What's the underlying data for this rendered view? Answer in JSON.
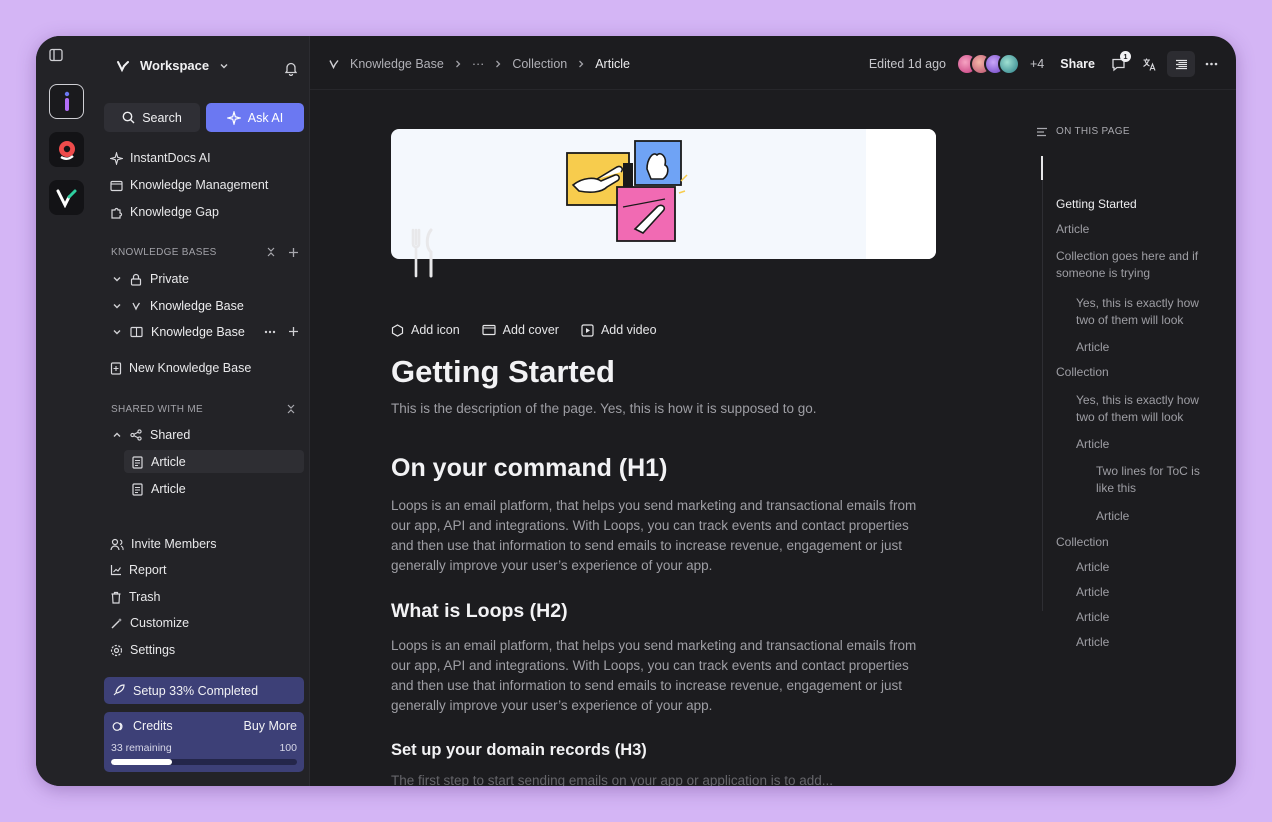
{
  "colors": {
    "page_bg": "#d4b5f5",
    "window_bg": "#1c1c1f",
    "sidebar_bg": "#232327",
    "accent": "#6b78f2",
    "setup_bg": "#3d4077"
  },
  "workspace": {
    "name": "Workspace"
  },
  "sidebar": {
    "search_label": "Search",
    "ask_ai_label": "Ask AI",
    "top_items": [
      {
        "label": "InstantDocs AI",
        "icon": "sparkle-icon"
      },
      {
        "label": "Knowledge Management",
        "icon": "folder-icon"
      },
      {
        "label": "Knowledge Gap",
        "icon": "puzzle-icon"
      }
    ],
    "kb_section": "KNOWLEDGE BASES",
    "kb_items": [
      {
        "label": "Private",
        "icon": "lock-icon"
      },
      {
        "label": "Knowledge Base",
        "icon": "logo-icon"
      },
      {
        "label": "Knowledge Base",
        "icon": "book-icon"
      }
    ],
    "new_kb": "New Knowledge Base",
    "shared_section": "SHARED WITH ME",
    "shared_folder": "Shared",
    "shared_articles": [
      "Article",
      "Article"
    ],
    "bottom_items": [
      {
        "label": "Invite Members",
        "icon": "users-icon"
      },
      {
        "label": "Report",
        "icon": "chart-icon"
      },
      {
        "label": "Trash",
        "icon": "trash-icon"
      },
      {
        "label": "Customize",
        "icon": "wand-icon"
      },
      {
        "label": "Settings",
        "icon": "gear-icon"
      }
    ],
    "setup_label": "Setup 33% Completed",
    "credits": {
      "label": "Credits",
      "buy_more": "Buy More",
      "remaining": "33 remaining",
      "max": "100",
      "progress": 0.33
    }
  },
  "topbar": {
    "breadcrumbs": [
      "Knowledge Base",
      "···",
      "Collection",
      "Article"
    ],
    "edited": "Edited 1d ago",
    "more_avatars": "+4",
    "share": "Share",
    "comment_badge": "1"
  },
  "doc": {
    "actions": [
      "Add icon",
      "Add cover",
      "Add video"
    ],
    "title": "Getting Started",
    "description": "This is the description of the page. Yes, this is how it is supposed to go.",
    "h1": "On your command (H1)",
    "p1": "Loops is an email platform, that helps you send marketing and transactional emails from our app, API and integrations. With Loops, you can track events and contact properties and then use that information to send emails to increase revenue, engagement or just generally improve your user’s experience of your app.",
    "h2": "What is Loops (H2)",
    "p2": "Loops is an email platform, that helps you send marketing and transactional emails from our app, API and integrations. With Loops, you can track events and contact properties and then use that information to send emails to increase revenue, engagement or just generally improve your user’s experience of your app.",
    "h3": "Set up your domain records (H3)",
    "p3_partial": "The first step to start sending emails on your app or application is to add..."
  },
  "toc": {
    "heading": "ON THIS PAGE",
    "items": [
      "Getting Started",
      "Article",
      "Collection goes here and if someone is trying",
      "Yes, this is exactly how two of them will look",
      "Article",
      "Collection",
      "Yes, this is exactly how two of them will look",
      "Article",
      "Two lines for ToC is like this",
      "Article",
      "Collection",
      "Article",
      "Article",
      "Article",
      "Article"
    ]
  }
}
